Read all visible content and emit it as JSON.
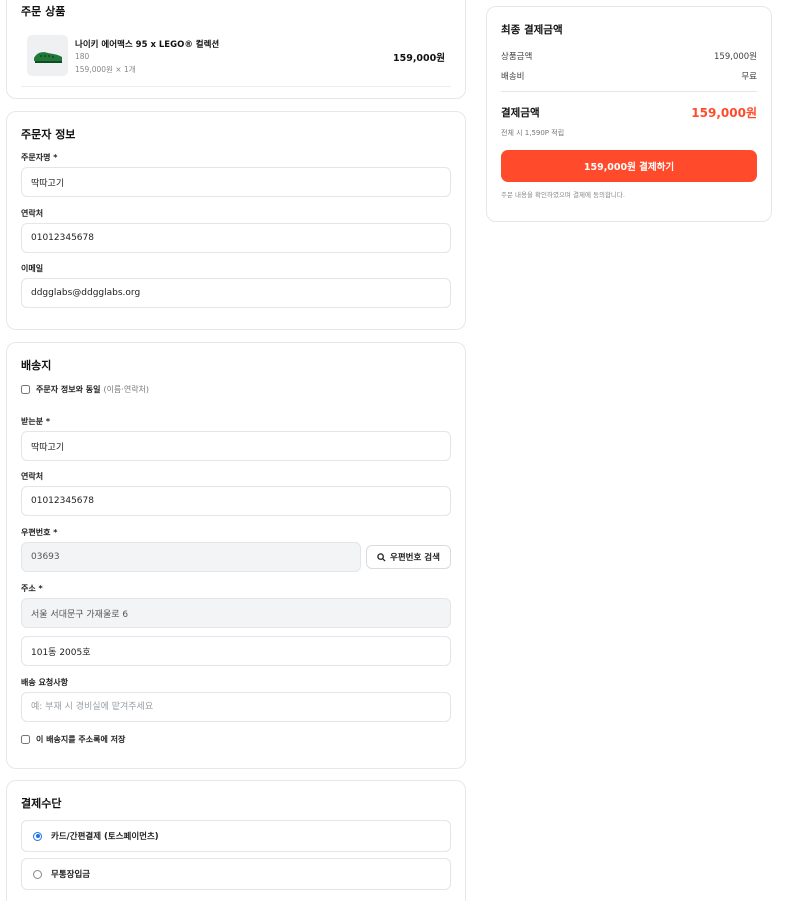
{
  "order_items": {
    "title": "주문 상품",
    "items": [
      {
        "name": "나이키 에어맥스 95 x LEGO® 컬렉션",
        "option": "180",
        "unit_price_qty": "159,000원 × 1개",
        "price": "159,000원"
      }
    ]
  },
  "orderer": {
    "title": "주문자 정보",
    "name_label": "주문자명",
    "name_value": "딱따고기",
    "phone_label": "연락처",
    "phone_value": "01012345678",
    "email_label": "이메일",
    "email_value": "ddgglabs@ddgglabs.org"
  },
  "shipping": {
    "title": "배송지",
    "same_as_orderer_label": "주문자 정보와 동일",
    "same_as_orderer_hint": "(이름·연락처)",
    "recipient_label": "받는분",
    "recipient_value": "딱따고기",
    "phone_label": "연락처",
    "phone_value": "01012345678",
    "zip_label": "우편번호",
    "zip_value": "03693",
    "zip_search_label": "우편번호 검색",
    "address_label": "주소",
    "address_value": "서울 서대문구 가재울로 6",
    "address_detail_value": "101동 2005호",
    "request_label": "배송 요청사항",
    "request_placeholder": "예: 부재 시 경비실에 맡겨주세요",
    "save_address_label": "이 배송지를 주소록에 저장"
  },
  "payment": {
    "title": "결제수단",
    "options": [
      {
        "label": "카드/간편결제 (토스페이먼츠)",
        "selected": true
      },
      {
        "label": "무통장입금",
        "selected": false
      }
    ]
  },
  "summary": {
    "title": "최종 결제금액",
    "product_amount_label": "상품금액",
    "product_amount_value": "159,000원",
    "shipping_fee_label": "배송비",
    "shipping_fee_value": "무료",
    "total_label": "결제금액",
    "total_value": "159,000원",
    "points_note": "전체 시 1,590P 적립",
    "pay_button_label": "159,000원 결제하기",
    "agreement_note": "주문 내용을 확인하였으며 결제에 동의합니다."
  },
  "required_mark": "*",
  "colors": {
    "accent": "#ff4b2b",
    "radio": "#1a73e8"
  }
}
